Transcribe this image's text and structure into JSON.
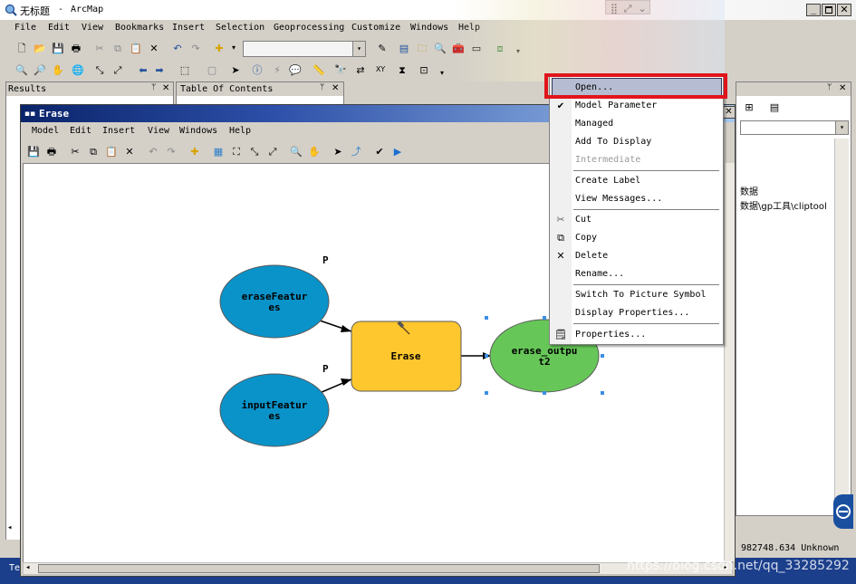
{
  "app": {
    "window_title_cn": "无标题",
    "window_title_sep": "-",
    "window_title_app": "ArcMap"
  },
  "main_menu": [
    "File",
    "Edit",
    "View",
    "Bookmarks",
    "Insert",
    "Selection",
    "Geoprocessing",
    "Customize",
    "Windows",
    "Help"
  ],
  "panels": {
    "results_title": "Results",
    "toc_title": "Table Of Contents"
  },
  "model_window": {
    "title": "Erase",
    "menu": [
      "Model",
      "Edit",
      "Insert",
      "View",
      "Windows",
      "Help"
    ]
  },
  "model": {
    "param_label_1": "P",
    "param_label_2": "P",
    "nodes": {
      "erase_features": [
        "eraseFeatur",
        "es"
      ],
      "input_features": [
        "inputFeatur",
        "es"
      ],
      "erase_tool": [
        "Erase"
      ],
      "erase_output": [
        "erase_outpu",
        "t2"
      ]
    },
    "colors": {
      "input_node": "#0a93c9",
      "tool_node": "#ffc72e",
      "output_node": "#66c758",
      "selection_handle": "#3c8ee6"
    }
  },
  "context_menu": {
    "items": [
      {
        "label": "Open...",
        "highlighted": true
      },
      {
        "label": "Model Parameter",
        "checked": true
      },
      {
        "label": "Managed"
      },
      {
        "label": "Add To Display"
      },
      {
        "label": "Intermediate",
        "disabled": true
      },
      {
        "label": "Create Label"
      },
      {
        "label": "View Messages..."
      },
      {
        "label": "Cut",
        "icon": "scissors-icon"
      },
      {
        "label": "Copy",
        "icon": "copy-icon"
      },
      {
        "label": "Delete",
        "icon": "delete-x-icon"
      },
      {
        "label": "Rename..."
      },
      {
        "label": "Switch To Picture Symbol"
      },
      {
        "label": "Display Properties..."
      },
      {
        "label": "Properties...",
        "icon": "properties-icon"
      }
    ],
    "highlight_outline_color": "#e0151b"
  },
  "right_panel": {
    "text_line_1": "数据",
    "text_line_2": "数据\\gp工具\\cliptool"
  },
  "status_bar": {
    "coordinates": "982748.634 Unknown",
    "left_fragment": "Te"
  },
  "watermark": "https://blog.csdn.net/qq_33285292"
}
